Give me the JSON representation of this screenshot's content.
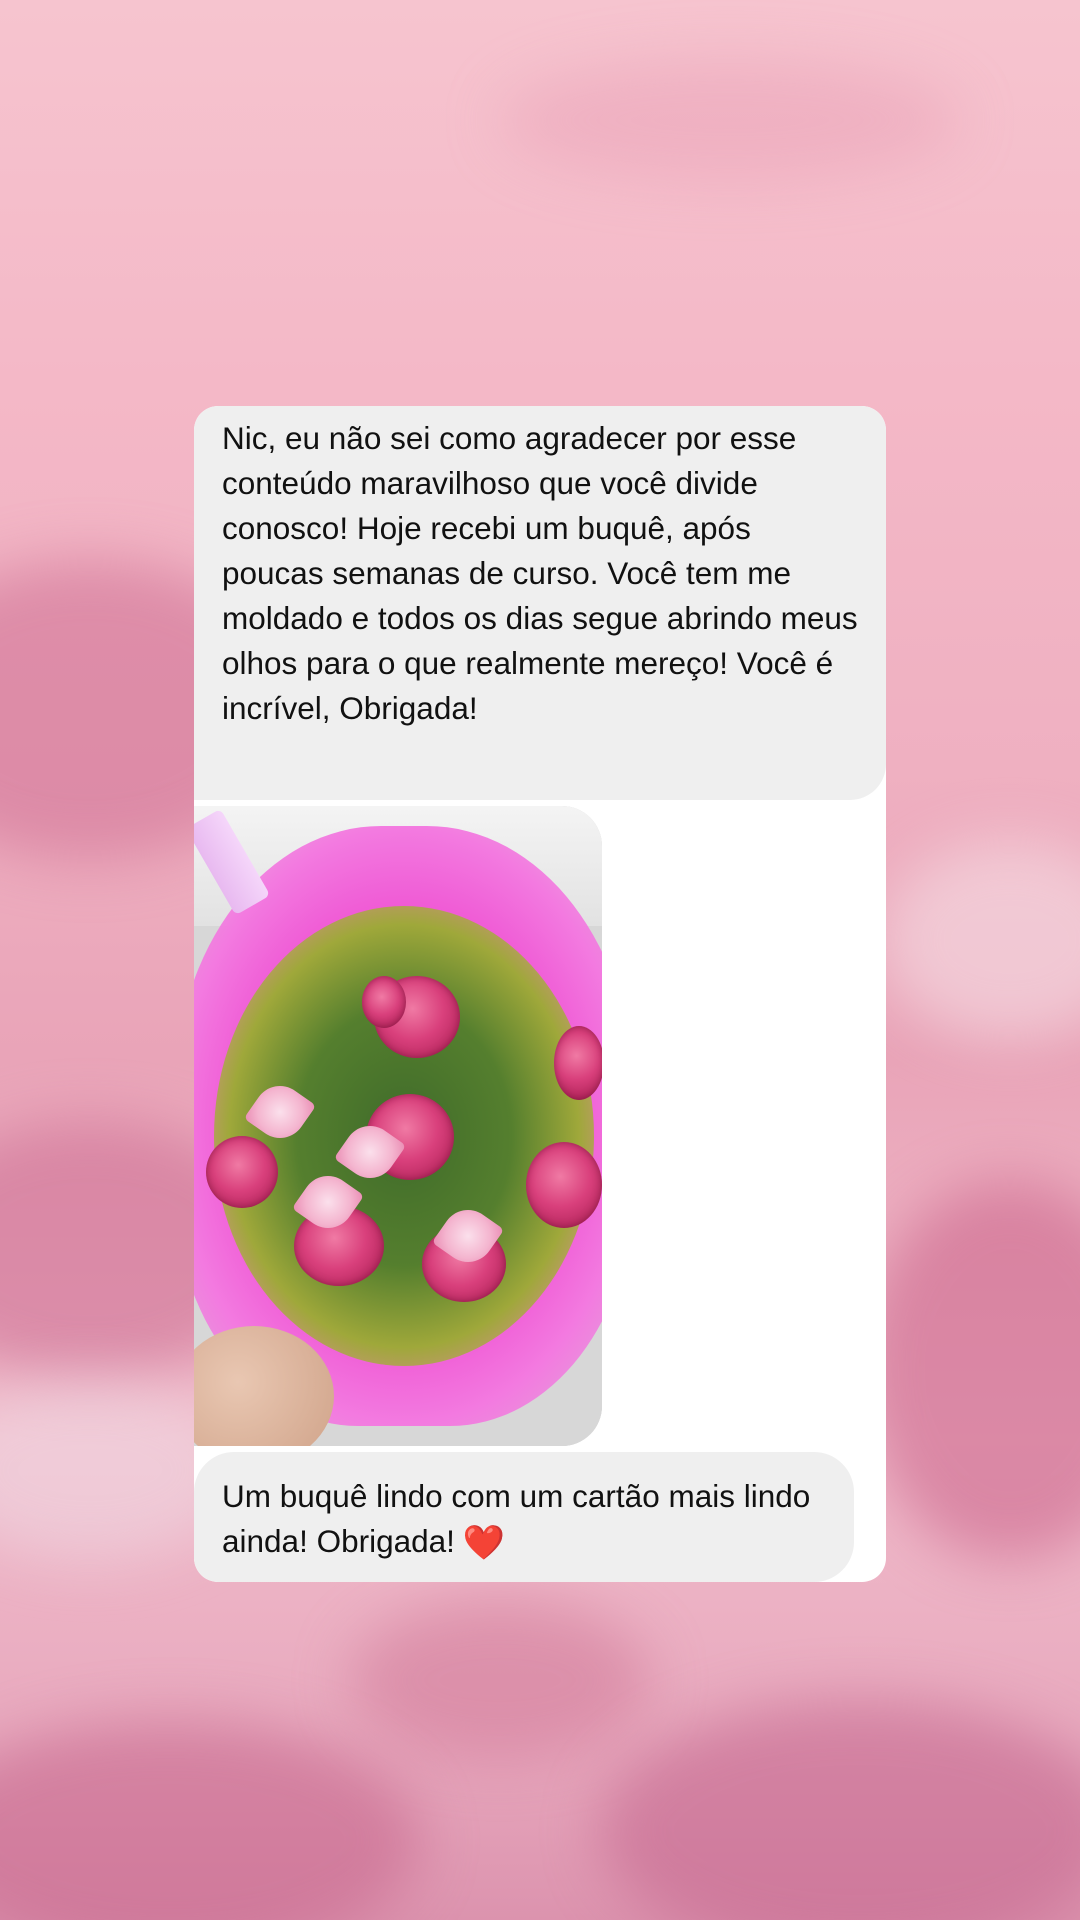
{
  "messages": [
    {
      "type": "text",
      "text": "Nic, eu não sei como agradecer por esse conteúdo maravilhoso que você divide conosco! Hoje recebi um buquê, após poucas semanas de curso. Você tem me moldado e todos os dias segue abrindo meus olhos para o que realmente mereço! Você é incrível, Obrigada!"
    },
    {
      "type": "photo",
      "icon": "bouquet-photo"
    },
    {
      "type": "text",
      "text": "Um buquê lindo com um cartão mais lindo ainda! Obrigada!",
      "emoji": "❤️"
    }
  ],
  "colors": {
    "bubble": "#efefef",
    "card": "#ffffff",
    "background": "#f1b4c4",
    "heart": "#e0263a"
  }
}
